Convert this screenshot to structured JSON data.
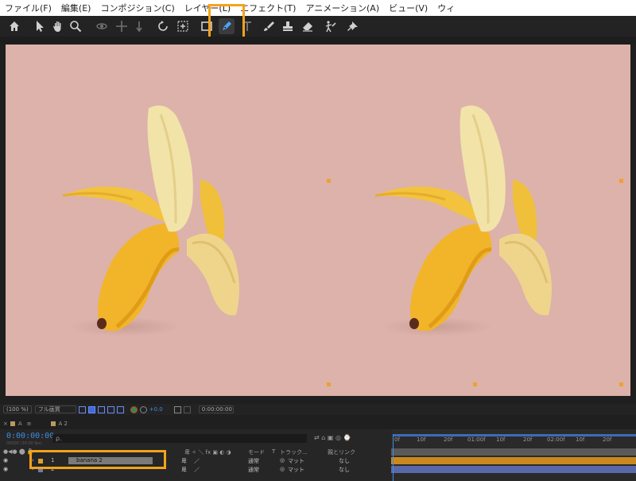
{
  "menu": [
    "ファイル(F)",
    "編集(E)",
    "コンポジション(C)",
    "レイヤー(L)",
    "エフェクト(T)",
    "アニメーション(A)",
    "ビュー(V)",
    "ウィ"
  ],
  "toolbar": {
    "tools": [
      "home-icon",
      "selection-arrow-icon",
      "hand-icon",
      "zoom-icon",
      "orbit-camera-icon",
      "pan-camera-icon",
      "dolly-camera-icon",
      "rotation-icon",
      "pan-behind-icon",
      "rectangle-icon",
      "pen-icon",
      "type-icon",
      "brush-icon",
      "clone-stamp-icon",
      "eraser-icon",
      "roto-brush-icon",
      "puppet-pin-icon"
    ],
    "active_tool": "pen-icon",
    "highlight_color": "#f5a31a"
  },
  "viewer": {
    "background_color": "#dcb2aa",
    "zoom": "(100 %)",
    "resolution": "フル画質",
    "exposure": "+0.0",
    "timecode": "0:00:00:00"
  },
  "timeline": {
    "tabs": [
      "A",
      "A 2"
    ],
    "timecode": "0:00:00:00",
    "frame_info": "00000 (30.00 fps)",
    "search_placeholder": "ρ.",
    "columns": {
      "mode": "モード",
      "t": "T",
      "track_matte": "トラック...",
      "parent_link": "親とリンク"
    },
    "layers": [
      {
        "index": "1",
        "name": "banana 2",
        "mode": "通常",
        "matte": "マット",
        "parent": "なし",
        "color": "#e0a030"
      },
      {
        "index": "2",
        "name": "",
        "mode": "通常",
        "matte": "マット",
        "parent": "なし",
        "color": "#6a7ab8"
      }
    ],
    "ruler": [
      "0f",
      "10f",
      "20f",
      "01:00f",
      "10f",
      "20f",
      "02:00f",
      "10f",
      "20f"
    ]
  }
}
